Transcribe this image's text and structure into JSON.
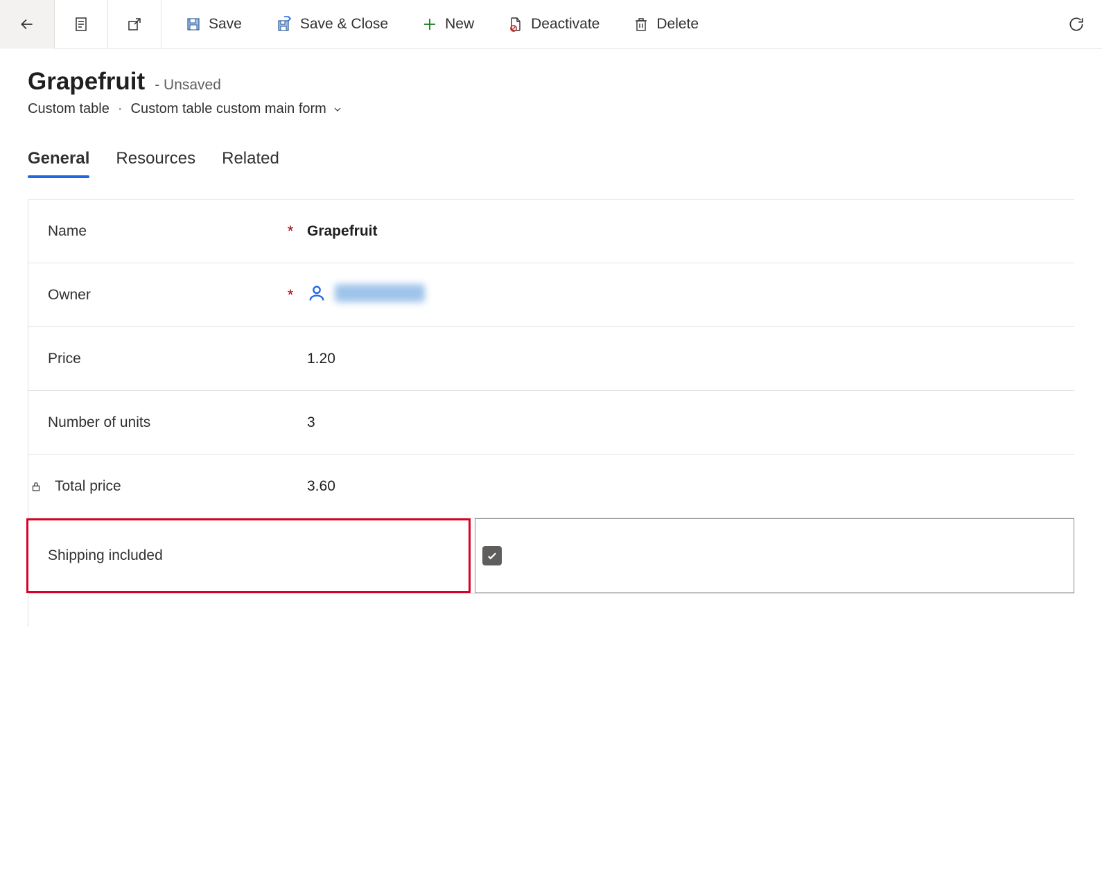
{
  "toolbar": {
    "save": "Save",
    "save_close": "Save & Close",
    "new": "New",
    "deactivate": "Deactivate",
    "delete": "Delete"
  },
  "header": {
    "title": "Grapefruit",
    "status": "- Unsaved",
    "entity": "Custom table",
    "form_name": "Custom table custom main form"
  },
  "tabs": {
    "general": "General",
    "resources": "Resources",
    "related": "Related"
  },
  "fields": {
    "name": {
      "label": "Name",
      "value": "Grapefruit"
    },
    "owner": {
      "label": "Owner"
    },
    "price": {
      "label": "Price",
      "value": "1.20"
    },
    "units": {
      "label": "Number of units",
      "value": "3"
    },
    "total": {
      "label": "Total price",
      "value": "3.60"
    },
    "shipping": {
      "label": "Shipping included",
      "checked": true
    }
  }
}
